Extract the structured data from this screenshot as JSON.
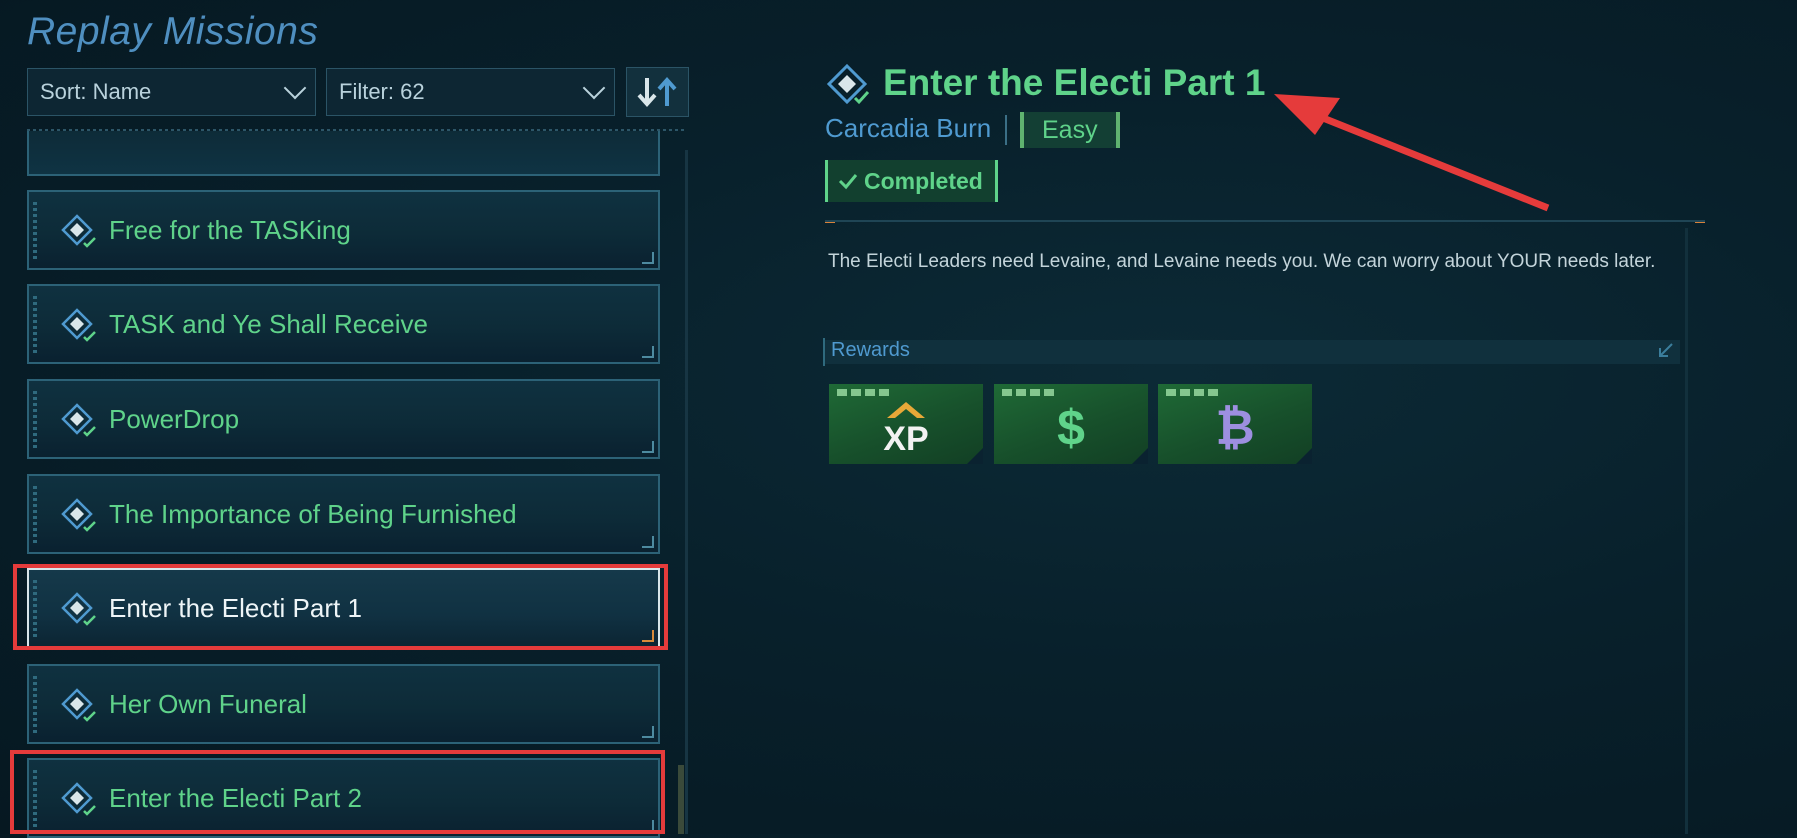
{
  "header": {
    "title": "Replay Missions"
  },
  "controls": {
    "sort_label": "Sort: Name",
    "filter_label": "Filter: 62"
  },
  "missions": [
    {
      "name": "Free for the TASKing"
    },
    {
      "name": "TASK and Ye Shall Receive"
    },
    {
      "name": "PowerDrop"
    },
    {
      "name": "The Importance of Being Furnished"
    },
    {
      "name": "Enter the Electi Part 1",
      "selected": true
    },
    {
      "name": "Her Own Funeral"
    },
    {
      "name": "Enter the Electi Part 2"
    }
  ],
  "detail": {
    "title": "Enter the Electi Part 1",
    "location": "Carcadia Burn",
    "difficulty": "Easy",
    "status": "Completed",
    "description": "The Electi Leaders need Levaine, and Levaine needs you. We can worry about YOUR needs later.",
    "rewards_label": "Rewards",
    "rewards": [
      {
        "icon": "xp-icon",
        "text": "XP"
      },
      {
        "icon": "credits-icon",
        "text": "$"
      },
      {
        "icon": "cred-alt-icon",
        "text": "₿"
      }
    ]
  },
  "colors": {
    "accent_green": "#5fd38a",
    "accent_blue": "#4f9ad0",
    "annotation_red": "#e53b3b"
  }
}
